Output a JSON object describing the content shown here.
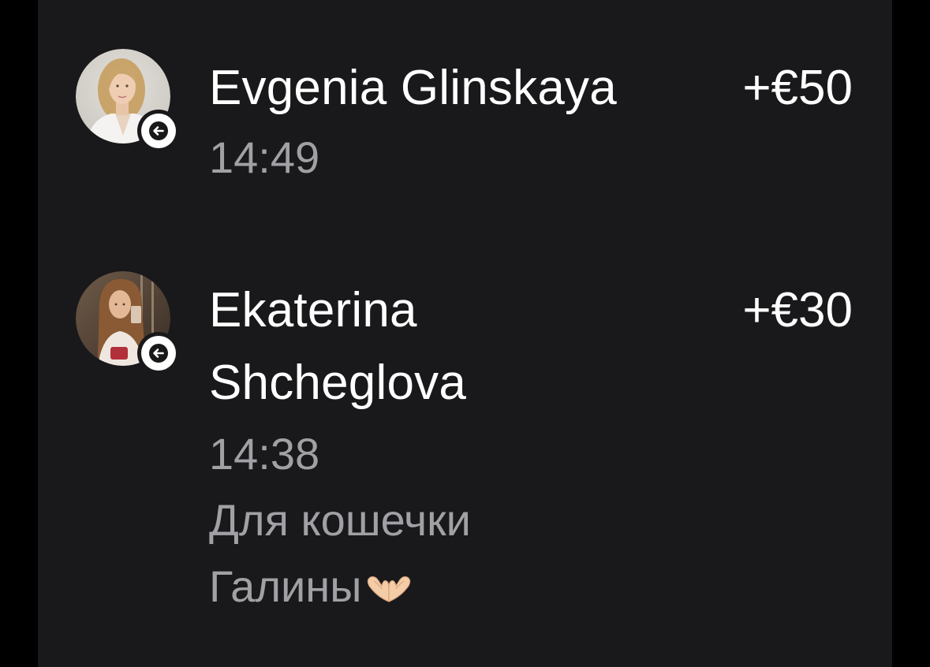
{
  "transactions": [
    {
      "name": "Evgenia Glinskaya",
      "amount": "+€50",
      "time": "14:49",
      "direction_icon": "arrow-left-icon"
    },
    {
      "name": "Ekaterina Shcheglova",
      "amount": "+€30",
      "time": "14:38",
      "comment": "Для кошечки Галины",
      "comment_emoji": "heart-hands-emoji",
      "direction_icon": "arrow-left-icon"
    }
  ],
  "colors": {
    "background": "#19191b",
    "primary_text": "#ffffff",
    "secondary_text": "#a0a0a5"
  }
}
